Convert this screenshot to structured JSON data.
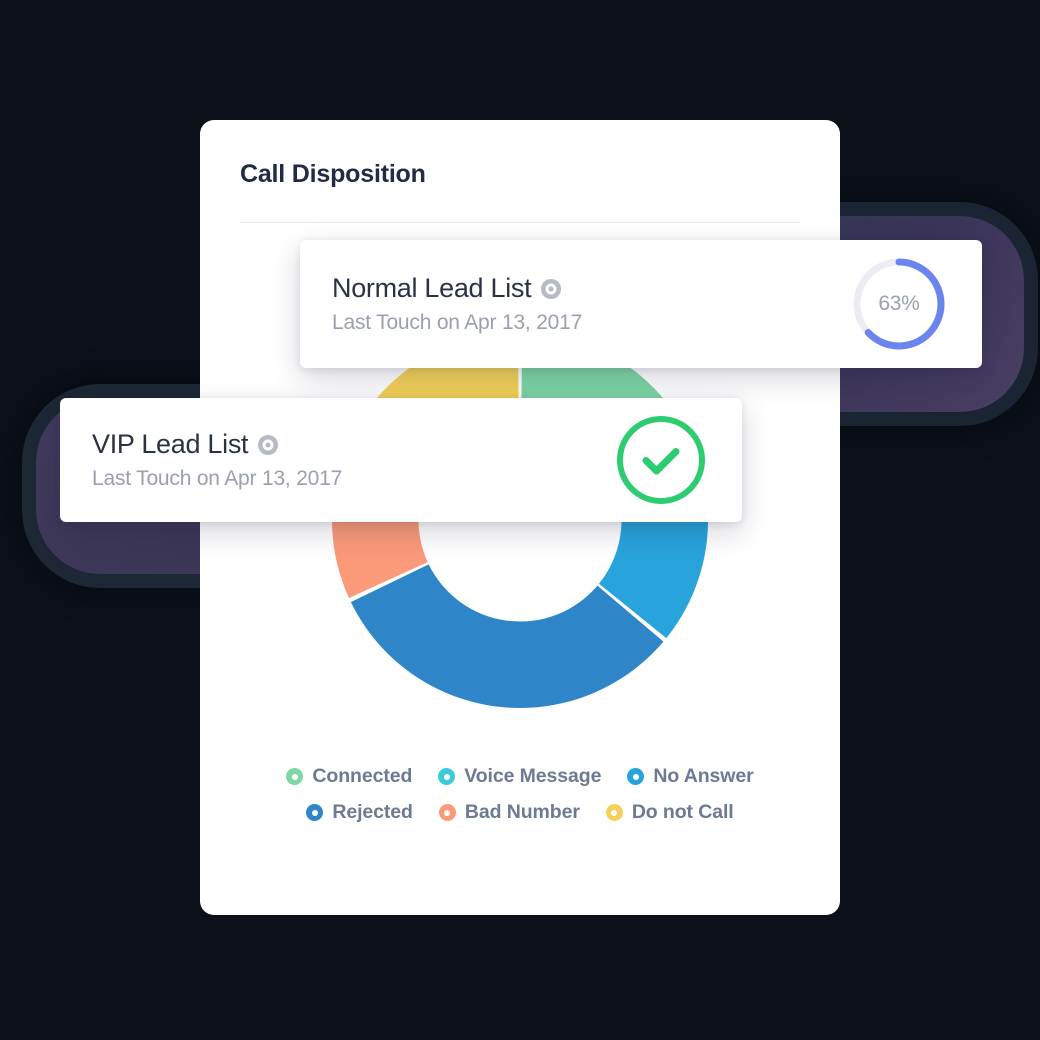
{
  "panel": {
    "title": "Call Disposition"
  },
  "cards": [
    {
      "id": "normal-lead-list",
      "title": "Normal Lead List",
      "subtitle": "Last Touch on Apr 13, 2017",
      "icon": "target-icon",
      "status_type": "progress-ring",
      "progress_value": 63,
      "progress_label": "63%",
      "progress_color": "#6b84ee",
      "progress_track_color": "#ebedf2"
    },
    {
      "id": "vip-lead-list",
      "title": "VIP Lead List",
      "subtitle": "Last Touch on Apr 13, 2017",
      "icon": "target-icon",
      "status_type": "check-badge",
      "check_color": "#2ecc71"
    }
  ],
  "chart_data": {
    "type": "pie",
    "variant": "donut",
    "title": "Call Disposition",
    "xlabel": "",
    "ylabel": "",
    "legend_position": "bottom",
    "grid": false,
    "inner_radius_ratio": 0.54,
    "start_angle_deg": -90,
    "categories": [
      "Connected",
      "Voice Message",
      "No Answer",
      "Rejected",
      "Bad Number",
      "Do not Call"
    ],
    "values": [
      14,
      10,
      12,
      32,
      12,
      20
    ],
    "colors": [
      "#7ed6a5",
      "#3ccbda",
      "#29a3dc",
      "#2e86c8",
      "#fb9a79",
      "#f5d159"
    ],
    "slices": [
      {
        "label": "Connected",
        "value": 14,
        "color": "#7ed6a5"
      },
      {
        "label": "Voice Message",
        "value": 10,
        "color": "#3ccbda"
      },
      {
        "label": "No Answer",
        "value": 12,
        "color": "#29a3dc"
      },
      {
        "label": "Rejected",
        "value": 32,
        "color": "#2e86c8"
      },
      {
        "label": "Bad Number",
        "value": 12,
        "color": "#fb9a79"
      },
      {
        "label": "Do not Call",
        "value": 20,
        "color": "#f5d159"
      }
    ]
  },
  "legend": {
    "rows": [
      [
        {
          "label": "Connected",
          "color": "#7ed6a5"
        },
        {
          "label": "Voice Message",
          "color": "#3ccbda"
        },
        {
          "label": "No Answer",
          "color": "#29a3dc"
        }
      ],
      [
        {
          "label": "Rejected",
          "color": "#2e86c8"
        },
        {
          "label": "Bad Number",
          "color": "#fb9a79"
        },
        {
          "label": "Do not Call",
          "color": "#f5d159"
        }
      ]
    ]
  },
  "theme": {
    "background": "#0b1019",
    "panel_background": "#ffffff",
    "title_color": "#222b45",
    "legend_text_color": "#6c7a93"
  }
}
